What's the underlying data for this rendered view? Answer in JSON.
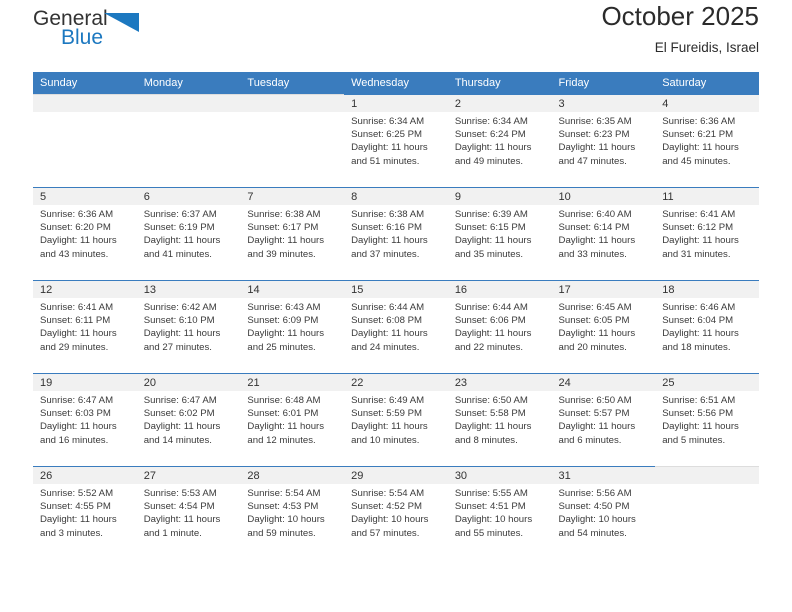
{
  "brand": {
    "word_one": "General",
    "word_two": "Blue",
    "triangle_color": "#1c78c0",
    "logo_icon": "triangle-flag-icon"
  },
  "header": {
    "title": "October 2025",
    "subtitle": "El Fureidis, Israel"
  },
  "theme": {
    "header_row_bg": "#3a7cbe",
    "daynum_bg": "#f1f1f1",
    "text": "#3b3b3b"
  },
  "calendar": {
    "weekday_headers": [
      "Sunday",
      "Monday",
      "Tuesday",
      "Wednesday",
      "Thursday",
      "Friday",
      "Saturday"
    ],
    "labels": {
      "sunrise": "Sunrise:",
      "sunset": "Sunset:",
      "daylight": "Daylight:"
    },
    "weeks": [
      [
        {
          "day": "",
          "sunrise": "",
          "sunset": "",
          "daylight": ""
        },
        {
          "day": "",
          "sunrise": "",
          "sunset": "",
          "daylight": ""
        },
        {
          "day": "",
          "sunrise": "",
          "sunset": "",
          "daylight": ""
        },
        {
          "day": "1",
          "sunrise": "Sunrise: 6:34 AM",
          "sunset": "Sunset: 6:25 PM",
          "daylight": "Daylight: 11 hours and 51 minutes."
        },
        {
          "day": "2",
          "sunrise": "Sunrise: 6:34 AM",
          "sunset": "Sunset: 6:24 PM",
          "daylight": "Daylight: 11 hours and 49 minutes."
        },
        {
          "day": "3",
          "sunrise": "Sunrise: 6:35 AM",
          "sunset": "Sunset: 6:23 PM",
          "daylight": "Daylight: 11 hours and 47 minutes."
        },
        {
          "day": "4",
          "sunrise": "Sunrise: 6:36 AM",
          "sunset": "Sunset: 6:21 PM",
          "daylight": "Daylight: 11 hours and 45 minutes."
        }
      ],
      [
        {
          "day": "5",
          "sunrise": "Sunrise: 6:36 AM",
          "sunset": "Sunset: 6:20 PM",
          "daylight": "Daylight: 11 hours and 43 minutes."
        },
        {
          "day": "6",
          "sunrise": "Sunrise: 6:37 AM",
          "sunset": "Sunset: 6:19 PM",
          "daylight": "Daylight: 11 hours and 41 minutes."
        },
        {
          "day": "7",
          "sunrise": "Sunrise: 6:38 AM",
          "sunset": "Sunset: 6:17 PM",
          "daylight": "Daylight: 11 hours and 39 minutes."
        },
        {
          "day": "8",
          "sunrise": "Sunrise: 6:38 AM",
          "sunset": "Sunset: 6:16 PM",
          "daylight": "Daylight: 11 hours and 37 minutes."
        },
        {
          "day": "9",
          "sunrise": "Sunrise: 6:39 AM",
          "sunset": "Sunset: 6:15 PM",
          "daylight": "Daylight: 11 hours and 35 minutes."
        },
        {
          "day": "10",
          "sunrise": "Sunrise: 6:40 AM",
          "sunset": "Sunset: 6:14 PM",
          "daylight": "Daylight: 11 hours and 33 minutes."
        },
        {
          "day": "11",
          "sunrise": "Sunrise: 6:41 AM",
          "sunset": "Sunset: 6:12 PM",
          "daylight": "Daylight: 11 hours and 31 minutes."
        }
      ],
      [
        {
          "day": "12",
          "sunrise": "Sunrise: 6:41 AM",
          "sunset": "Sunset: 6:11 PM",
          "daylight": "Daylight: 11 hours and 29 minutes."
        },
        {
          "day": "13",
          "sunrise": "Sunrise: 6:42 AM",
          "sunset": "Sunset: 6:10 PM",
          "daylight": "Daylight: 11 hours and 27 minutes."
        },
        {
          "day": "14",
          "sunrise": "Sunrise: 6:43 AM",
          "sunset": "Sunset: 6:09 PM",
          "daylight": "Daylight: 11 hours and 25 minutes."
        },
        {
          "day": "15",
          "sunrise": "Sunrise: 6:44 AM",
          "sunset": "Sunset: 6:08 PM",
          "daylight": "Daylight: 11 hours and 24 minutes."
        },
        {
          "day": "16",
          "sunrise": "Sunrise: 6:44 AM",
          "sunset": "Sunset: 6:06 PM",
          "daylight": "Daylight: 11 hours and 22 minutes."
        },
        {
          "day": "17",
          "sunrise": "Sunrise: 6:45 AM",
          "sunset": "Sunset: 6:05 PM",
          "daylight": "Daylight: 11 hours and 20 minutes."
        },
        {
          "day": "18",
          "sunrise": "Sunrise: 6:46 AM",
          "sunset": "Sunset: 6:04 PM",
          "daylight": "Daylight: 11 hours and 18 minutes."
        }
      ],
      [
        {
          "day": "19",
          "sunrise": "Sunrise: 6:47 AM",
          "sunset": "Sunset: 6:03 PM",
          "daylight": "Daylight: 11 hours and 16 minutes."
        },
        {
          "day": "20",
          "sunrise": "Sunrise: 6:47 AM",
          "sunset": "Sunset: 6:02 PM",
          "daylight": "Daylight: 11 hours and 14 minutes."
        },
        {
          "day": "21",
          "sunrise": "Sunrise: 6:48 AM",
          "sunset": "Sunset: 6:01 PM",
          "daylight": "Daylight: 11 hours and 12 minutes."
        },
        {
          "day": "22",
          "sunrise": "Sunrise: 6:49 AM",
          "sunset": "Sunset: 5:59 PM",
          "daylight": "Daylight: 11 hours and 10 minutes."
        },
        {
          "day": "23",
          "sunrise": "Sunrise: 6:50 AM",
          "sunset": "Sunset: 5:58 PM",
          "daylight": "Daylight: 11 hours and 8 minutes."
        },
        {
          "day": "24",
          "sunrise": "Sunrise: 6:50 AM",
          "sunset": "Sunset: 5:57 PM",
          "daylight": "Daylight: 11 hours and 6 minutes."
        },
        {
          "day": "25",
          "sunrise": "Sunrise: 6:51 AM",
          "sunset": "Sunset: 5:56 PM",
          "daylight": "Daylight: 11 hours and 5 minutes."
        }
      ],
      [
        {
          "day": "26",
          "sunrise": "Sunrise: 5:52 AM",
          "sunset": "Sunset: 4:55 PM",
          "daylight": "Daylight: 11 hours and 3 minutes."
        },
        {
          "day": "27",
          "sunrise": "Sunrise: 5:53 AM",
          "sunset": "Sunset: 4:54 PM",
          "daylight": "Daylight: 11 hours and 1 minute."
        },
        {
          "day": "28",
          "sunrise": "Sunrise: 5:54 AM",
          "sunset": "Sunset: 4:53 PM",
          "daylight": "Daylight: 10 hours and 59 minutes."
        },
        {
          "day": "29",
          "sunrise": "Sunrise: 5:54 AM",
          "sunset": "Sunset: 4:52 PM",
          "daylight": "Daylight: 10 hours and 57 minutes."
        },
        {
          "day": "30",
          "sunrise": "Sunrise: 5:55 AM",
          "sunset": "Sunset: 4:51 PM",
          "daylight": "Daylight: 10 hours and 55 minutes."
        },
        {
          "day": "31",
          "sunrise": "Sunrise: 5:56 AM",
          "sunset": "Sunset: 4:50 PM",
          "daylight": "Daylight: 10 hours and 54 minutes."
        },
        {
          "day": "",
          "sunrise": "",
          "sunset": "",
          "daylight": ""
        }
      ]
    ]
  }
}
